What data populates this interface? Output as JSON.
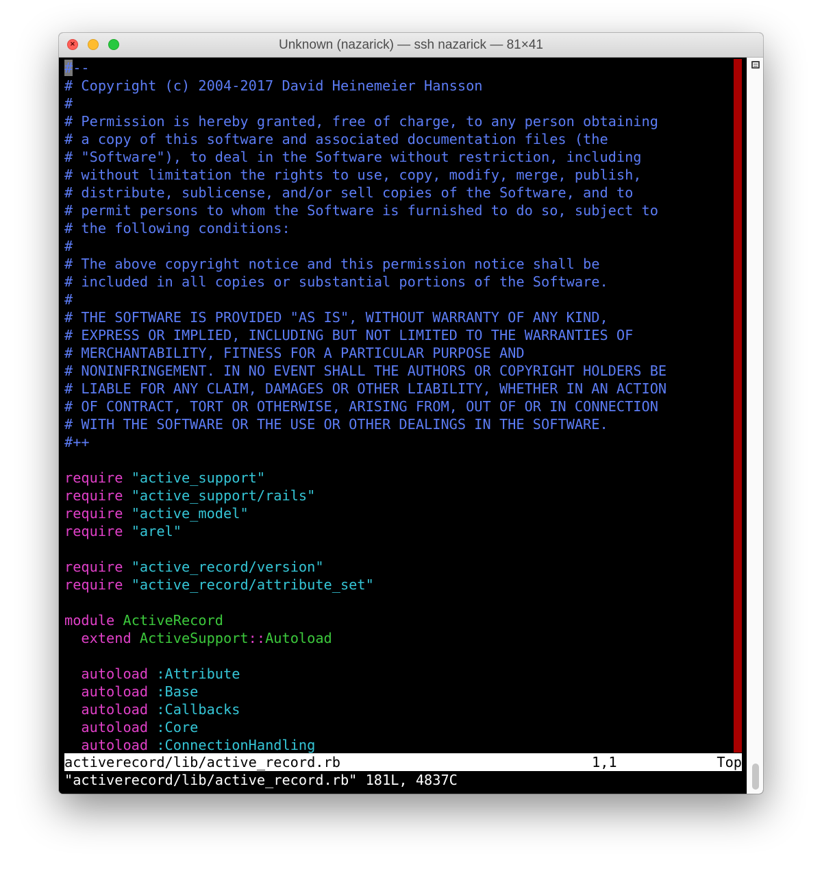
{
  "window": {
    "title": "Unknown (nazarick) — ssh nazarick — 81×41"
  },
  "editor": {
    "lines": [
      [
        {
          "t": "#",
          "c": "cursor"
        },
        {
          "t": "--",
          "c": "comment"
        }
      ],
      [
        {
          "t": "# Copyright (c) 2004-2017 David Heinemeier Hansson",
          "c": "comment"
        }
      ],
      [
        {
          "t": "#",
          "c": "comment"
        }
      ],
      [
        {
          "t": "# Permission is hereby granted, free of charge, to any person obtaining",
          "c": "comment"
        }
      ],
      [
        {
          "t": "# a copy of this software and associated documentation files (the",
          "c": "comment"
        }
      ],
      [
        {
          "t": "# \"Software\"), to deal in the Software without restriction, including",
          "c": "comment"
        }
      ],
      [
        {
          "t": "# without limitation the rights to use, copy, modify, merge, publish,",
          "c": "comment"
        }
      ],
      [
        {
          "t": "# distribute, sublicense, and/or sell copies of the Software, and to",
          "c": "comment"
        }
      ],
      [
        {
          "t": "# permit persons to whom the Software is furnished to do so, subject to",
          "c": "comment"
        }
      ],
      [
        {
          "t": "# the following conditions:",
          "c": "comment"
        }
      ],
      [
        {
          "t": "#",
          "c": "comment"
        }
      ],
      [
        {
          "t": "# The above copyright notice and this permission notice shall be",
          "c": "comment"
        }
      ],
      [
        {
          "t": "# included in all copies or substantial portions of the Software.",
          "c": "comment"
        }
      ],
      [
        {
          "t": "#",
          "c": "comment"
        }
      ],
      [
        {
          "t": "# THE SOFTWARE IS PROVIDED \"AS IS\", WITHOUT WARRANTY OF ANY KIND,",
          "c": "comment"
        }
      ],
      [
        {
          "t": "# EXPRESS OR IMPLIED, INCLUDING BUT NOT LIMITED TO THE WARRANTIES OF",
          "c": "comment"
        }
      ],
      [
        {
          "t": "# MERCHANTABILITY, FITNESS FOR A PARTICULAR PURPOSE AND",
          "c": "comment"
        }
      ],
      [
        {
          "t": "# NONINFRINGEMENT. IN NO EVENT SHALL THE AUTHORS OR COPYRIGHT HOLDERS BE",
          "c": "comment"
        }
      ],
      [
        {
          "t": "# LIABLE FOR ANY CLAIM, DAMAGES OR OTHER LIABILITY, WHETHER IN AN ACTION",
          "c": "comment"
        }
      ],
      [
        {
          "t": "# OF CONTRACT, TORT OR OTHERWISE, ARISING FROM, OUT OF OR IN CONNECTION",
          "c": "comment"
        }
      ],
      [
        {
          "t": "# WITH THE SOFTWARE OR THE USE OR OTHER DEALINGS IN THE SOFTWARE.",
          "c": "comment"
        }
      ],
      [
        {
          "t": "#++",
          "c": "comment"
        }
      ],
      [],
      [
        {
          "t": "require",
          "c": "kw"
        },
        {
          "t": " ",
          "c": "plain"
        },
        {
          "t": "\"active_support\"",
          "c": "str"
        }
      ],
      [
        {
          "t": "require",
          "c": "kw"
        },
        {
          "t": " ",
          "c": "plain"
        },
        {
          "t": "\"active_support/rails\"",
          "c": "str"
        }
      ],
      [
        {
          "t": "require",
          "c": "kw"
        },
        {
          "t": " ",
          "c": "plain"
        },
        {
          "t": "\"active_model\"",
          "c": "str"
        }
      ],
      [
        {
          "t": "require",
          "c": "kw"
        },
        {
          "t": " ",
          "c": "plain"
        },
        {
          "t": "\"arel\"",
          "c": "str"
        }
      ],
      [],
      [
        {
          "t": "require",
          "c": "kw"
        },
        {
          "t": " ",
          "c": "plain"
        },
        {
          "t": "\"active_record/version\"",
          "c": "str"
        }
      ],
      [
        {
          "t": "require",
          "c": "kw"
        },
        {
          "t": " ",
          "c": "plain"
        },
        {
          "t": "\"active_record/attribute_set\"",
          "c": "str"
        }
      ],
      [],
      [
        {
          "t": "module",
          "c": "kw"
        },
        {
          "t": " ",
          "c": "plain"
        },
        {
          "t": "ActiveRecord",
          "c": "const"
        }
      ],
      [
        {
          "t": "  ",
          "c": "plain"
        },
        {
          "t": "extend",
          "c": "kw"
        },
        {
          "t": " ",
          "c": "plain"
        },
        {
          "t": "ActiveSupport",
          "c": "const"
        },
        {
          "t": "::",
          "c": "kw"
        },
        {
          "t": "Autoload",
          "c": "const"
        }
      ],
      [],
      [
        {
          "t": "  ",
          "c": "plain"
        },
        {
          "t": "autoload",
          "c": "kw"
        },
        {
          "t": " ",
          "c": "plain"
        },
        {
          "t": ":Attribute",
          "c": "str"
        }
      ],
      [
        {
          "t": "  ",
          "c": "plain"
        },
        {
          "t": "autoload",
          "c": "kw"
        },
        {
          "t": " ",
          "c": "plain"
        },
        {
          "t": ":Base",
          "c": "str"
        }
      ],
      [
        {
          "t": "  ",
          "c": "plain"
        },
        {
          "t": "autoload",
          "c": "kw"
        },
        {
          "t": " ",
          "c": "plain"
        },
        {
          "t": ":Callbacks",
          "c": "str"
        }
      ],
      [
        {
          "t": "  ",
          "c": "plain"
        },
        {
          "t": "autoload",
          "c": "kw"
        },
        {
          "t": " ",
          "c": "plain"
        },
        {
          "t": ":Core",
          "c": "str"
        }
      ],
      [
        {
          "t": "  ",
          "c": "plain"
        },
        {
          "t": "autoload",
          "c": "kw"
        },
        {
          "t": " ",
          "c": "plain"
        },
        {
          "t": ":ConnectionHandling",
          "c": "str"
        }
      ]
    ]
  },
  "statusline": {
    "filename": "activerecord/lib/active_record.rb",
    "position": "1,1",
    "scroll": "Top"
  },
  "cmdline": {
    "message": "\"activerecord/lib/active_record.rb\" 181L, 4837C"
  },
  "colors": {
    "comment": "#5c7cf5",
    "keyword": "#e040c8",
    "string": "#35c5d6",
    "constant": "#3cc83c",
    "colorcolumn": "#a80000"
  }
}
